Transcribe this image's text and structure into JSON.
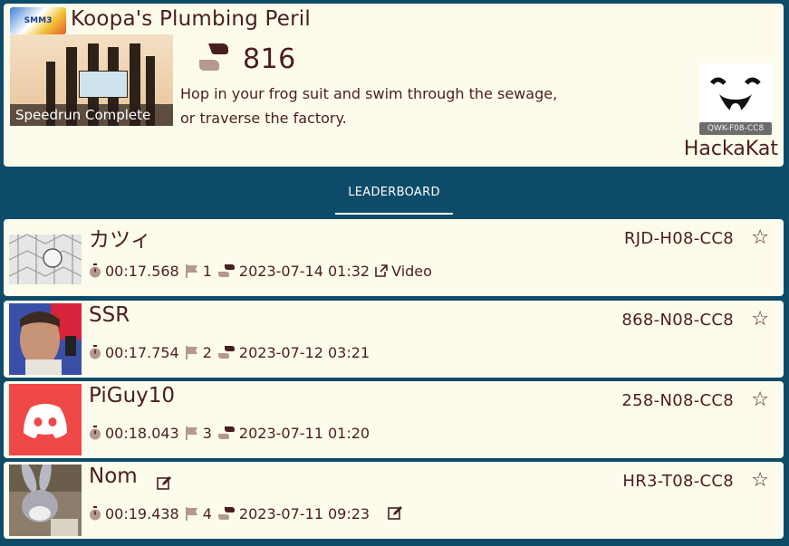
{
  "level": {
    "game_logo_text": "Super Mario Maker 3",
    "title": "Koopa's Plumbing Peril",
    "thumbnail_caption": "Speedrun Complete",
    "boot_count": "816",
    "description_line1": "Hop in your frog suit and swim through the sewage,",
    "description_line2": "or traverse the factory.",
    "creator": {
      "code": "QWK-F08-CC8",
      "name": "HackaKat"
    }
  },
  "tabs": {
    "active": "LEADERBOARD"
  },
  "leaderboard": [
    {
      "name": "カツィ",
      "code": "RJD-H08-CC8",
      "time": "00:17.568",
      "rank": "1",
      "date": "2023-07-14 01:32",
      "video_label": "Video"
    },
    {
      "name": "SSR",
      "code": "868-N08-CC8",
      "time": "00:17.754",
      "rank": "2",
      "date": "2023-07-12 03:21"
    },
    {
      "name": "PiGuy10",
      "code": "258-N08-CC8",
      "time": "00:18.043",
      "rank": "3",
      "date": "2023-07-11 01:20"
    },
    {
      "name": "Nom",
      "code": "HR3-T08-CC8",
      "time": "00:19.438",
      "rank": "4",
      "date": "2023-07-11 09:23"
    }
  ],
  "colors": {
    "page_background": "#0e4b68",
    "card_background": "#fdfbeb",
    "text": "#4a1e1e",
    "discord_red": "#f04747"
  },
  "icons": {
    "boots": "boot-icon",
    "timer": "stopwatch-icon",
    "rank": "flag-icon",
    "video": "external-link-icon",
    "favorite": "star-outline-icon",
    "edit": "edit-icon"
  }
}
